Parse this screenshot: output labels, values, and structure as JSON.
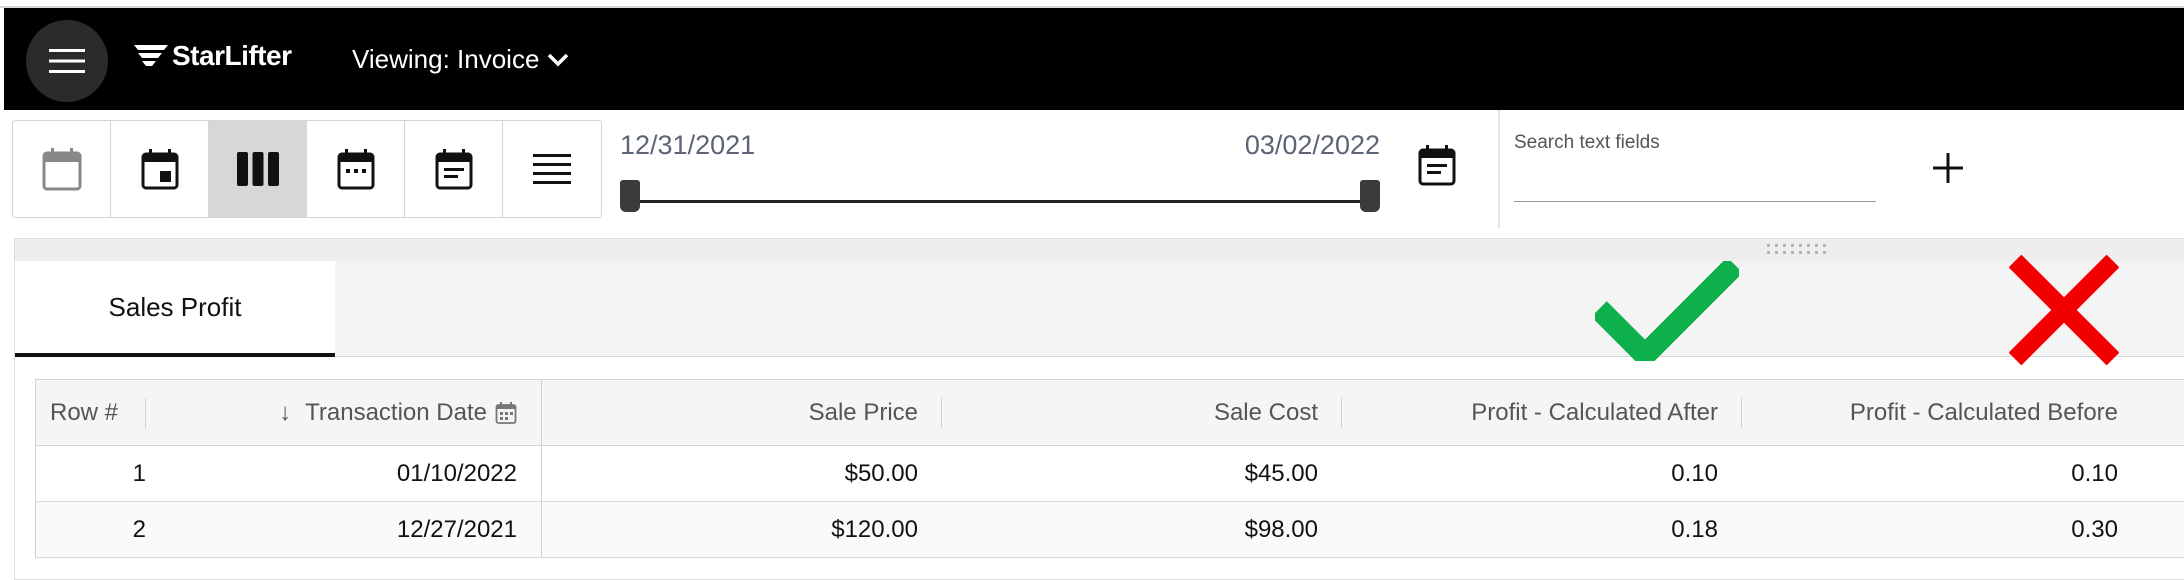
{
  "header": {
    "logo_text": "StarLifter",
    "viewing_label": "Viewing: Invoice"
  },
  "toolbar": {
    "view_buttons": [
      {
        "icon": "calendar-blank-icon",
        "active": false
      },
      {
        "icon": "calendar-day-icon",
        "active": false
      },
      {
        "icon": "columns-icon",
        "active": true
      },
      {
        "icon": "calendar-month-icon",
        "active": false
      },
      {
        "icon": "calendar-agenda-icon",
        "active": false
      },
      {
        "icon": "list-icon",
        "active": false
      }
    ],
    "date_start": "12/31/2021",
    "date_end": "03/02/2022",
    "search_label": "Search text fields",
    "search_value": ""
  },
  "tabs": [
    {
      "label": "Sales Profit",
      "active": true
    }
  ],
  "indicators": {
    "check_color": "#0db04b",
    "x_color": "#f20000"
  },
  "grid": {
    "columns": [
      "Row #",
      "Transaction Date",
      "Sale Price",
      "Sale Cost",
      "Profit - Calculated After",
      "Profit - Calculated Before"
    ],
    "rows": [
      [
        "1",
        "01/10/2022",
        "$50.00",
        "$45.00",
        "0.10",
        "0.10"
      ],
      [
        "2",
        "12/27/2021",
        "$120.00",
        "$98.00",
        "0.18",
        "0.30"
      ]
    ]
  },
  "colors": {
    "header_bg": "#000000",
    "active_view_bg": "#d7d7d7",
    "date_text": "#5d6476"
  }
}
